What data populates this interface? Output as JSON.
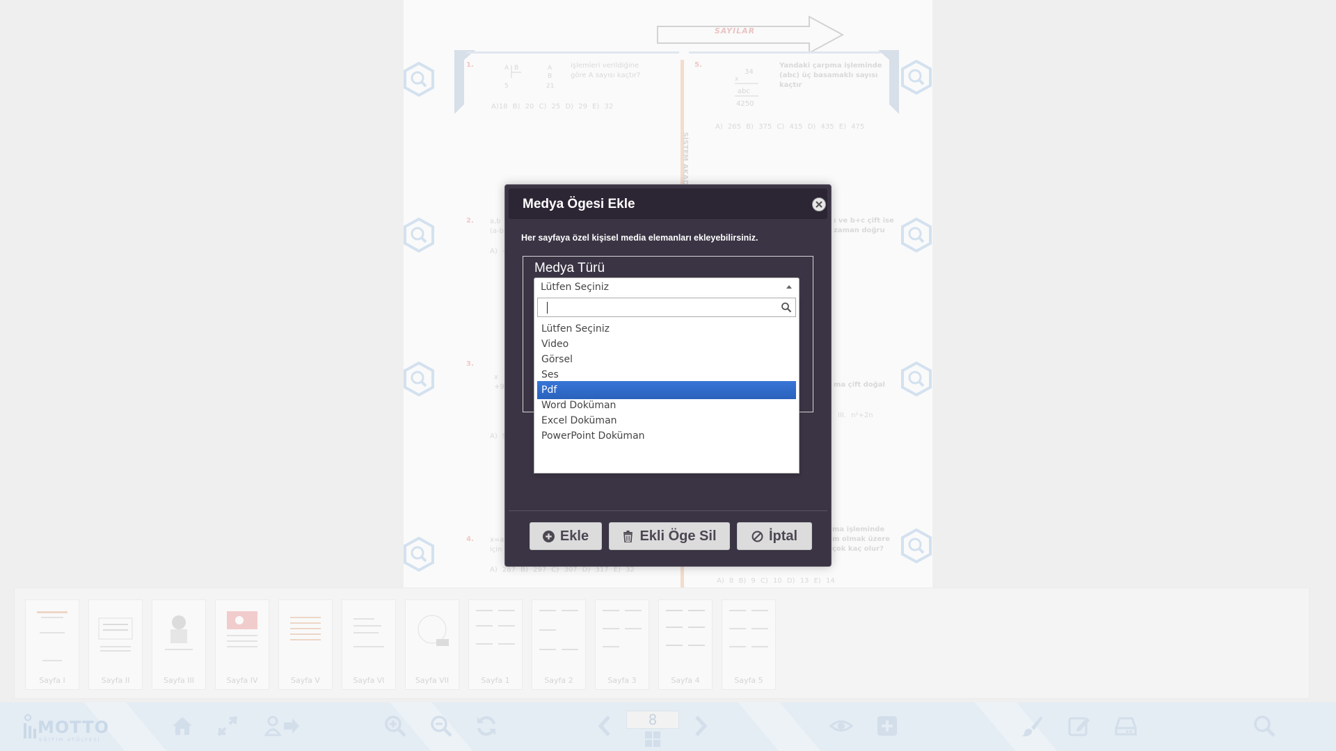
{
  "background_page": {
    "topic": "SAYILAR",
    "side_text": "SİSTEM AKADEMİ",
    "questions": [
      {
        "num": "1.",
        "text_lines": [
          "işlemleri verildiğine",
          "göre A sayısı kaçtır?"
        ],
        "options": "A)18 B) 20 C) 25 D) 29 E) 32"
      },
      {
        "num": "5.",
        "text_lines": [
          "Yandaki çarpma işleminde",
          "(abc) üç basamaklı sayısı",
          "kaçtır"
        ],
        "options": "A) 265 B) 375 C) 415 D) 435 E) 475"
      },
      {
        "num": "2.",
        "text_lines": [
          "a,b",
          "(a-b"
        ],
        "options": "A) -"
      },
      {
        "num": "3.",
        "text_lines": [
          "x",
          "+9"
        ],
        "options": "A) 9"
      },
      {
        "num": "4.",
        "text_lines": [
          "x=a",
          "için"
        ],
        "options": "A) 287 B) 297 C) 307 D) 317 E) 32"
      },
      {
        "num": "",
        "text_lines": [
          "ı ve b+c çift ise",
          "zaman doğru"
        ],
        "options": ""
      },
      {
        "num": "",
        "text_lines": [
          "ma çift doğal"
        ],
        "options": "III. n²+2n"
      },
      {
        "num": "",
        "text_lines": [
          "ma işleminde",
          "m olmak üzere",
          "çok kaç olur?"
        ],
        "options": "A) 8 B) 9 C) 10 D) 13 E) 14"
      }
    ]
  },
  "thumbnails": [
    "Sayfa I",
    "Sayfa II",
    "Sayfa III",
    "Sayfa IV",
    "Sayfa V",
    "Sayfa VI",
    "Sayfa VII",
    "Sayfa 1",
    "Sayfa 2",
    "Sayfa 3",
    "Sayfa 4",
    "Sayfa 5"
  ],
  "toolbar": {
    "logo_text": "MOTTO",
    "logo_sub": "EĞİTİM ATÖLYESİ",
    "current_page": "8",
    "icons": [
      "home-icon",
      "fullscreen-icon",
      "user-logout-icon",
      "zoom-in-icon",
      "zoom-out-icon",
      "refresh-icon",
      "prev-page-icon",
      "grid-icon",
      "next-page-icon",
      "eye-icon",
      "add-icon",
      "brush-icon",
      "edit-icon",
      "drive-icon",
      "search-icon"
    ]
  },
  "modal": {
    "title": "Medya Ögesi Ekle",
    "description": "Her sayfaya özel kişisel media elemanları ekleyebilirsiniz.",
    "legend": "Medya Türü",
    "select": {
      "value": "Lütfen Seçiniz",
      "search_value": "",
      "options": [
        "Lütfen Seçiniz",
        "Video",
        "Görsel",
        "Ses",
        "Pdf",
        "Word Doküman",
        "Excel Doküman",
        "PowerPoint Doküman"
      ],
      "highlighted": "Pdf"
    },
    "buttons": {
      "add": "Ekle",
      "remove": "Ekli Öge Sil",
      "cancel": "İptal"
    }
  },
  "colors": {
    "modal_bg": "#3a3444",
    "modal_header": "#2c2534",
    "highlight": "#3875d7",
    "toolbar_bg": "#e4ecf4"
  }
}
